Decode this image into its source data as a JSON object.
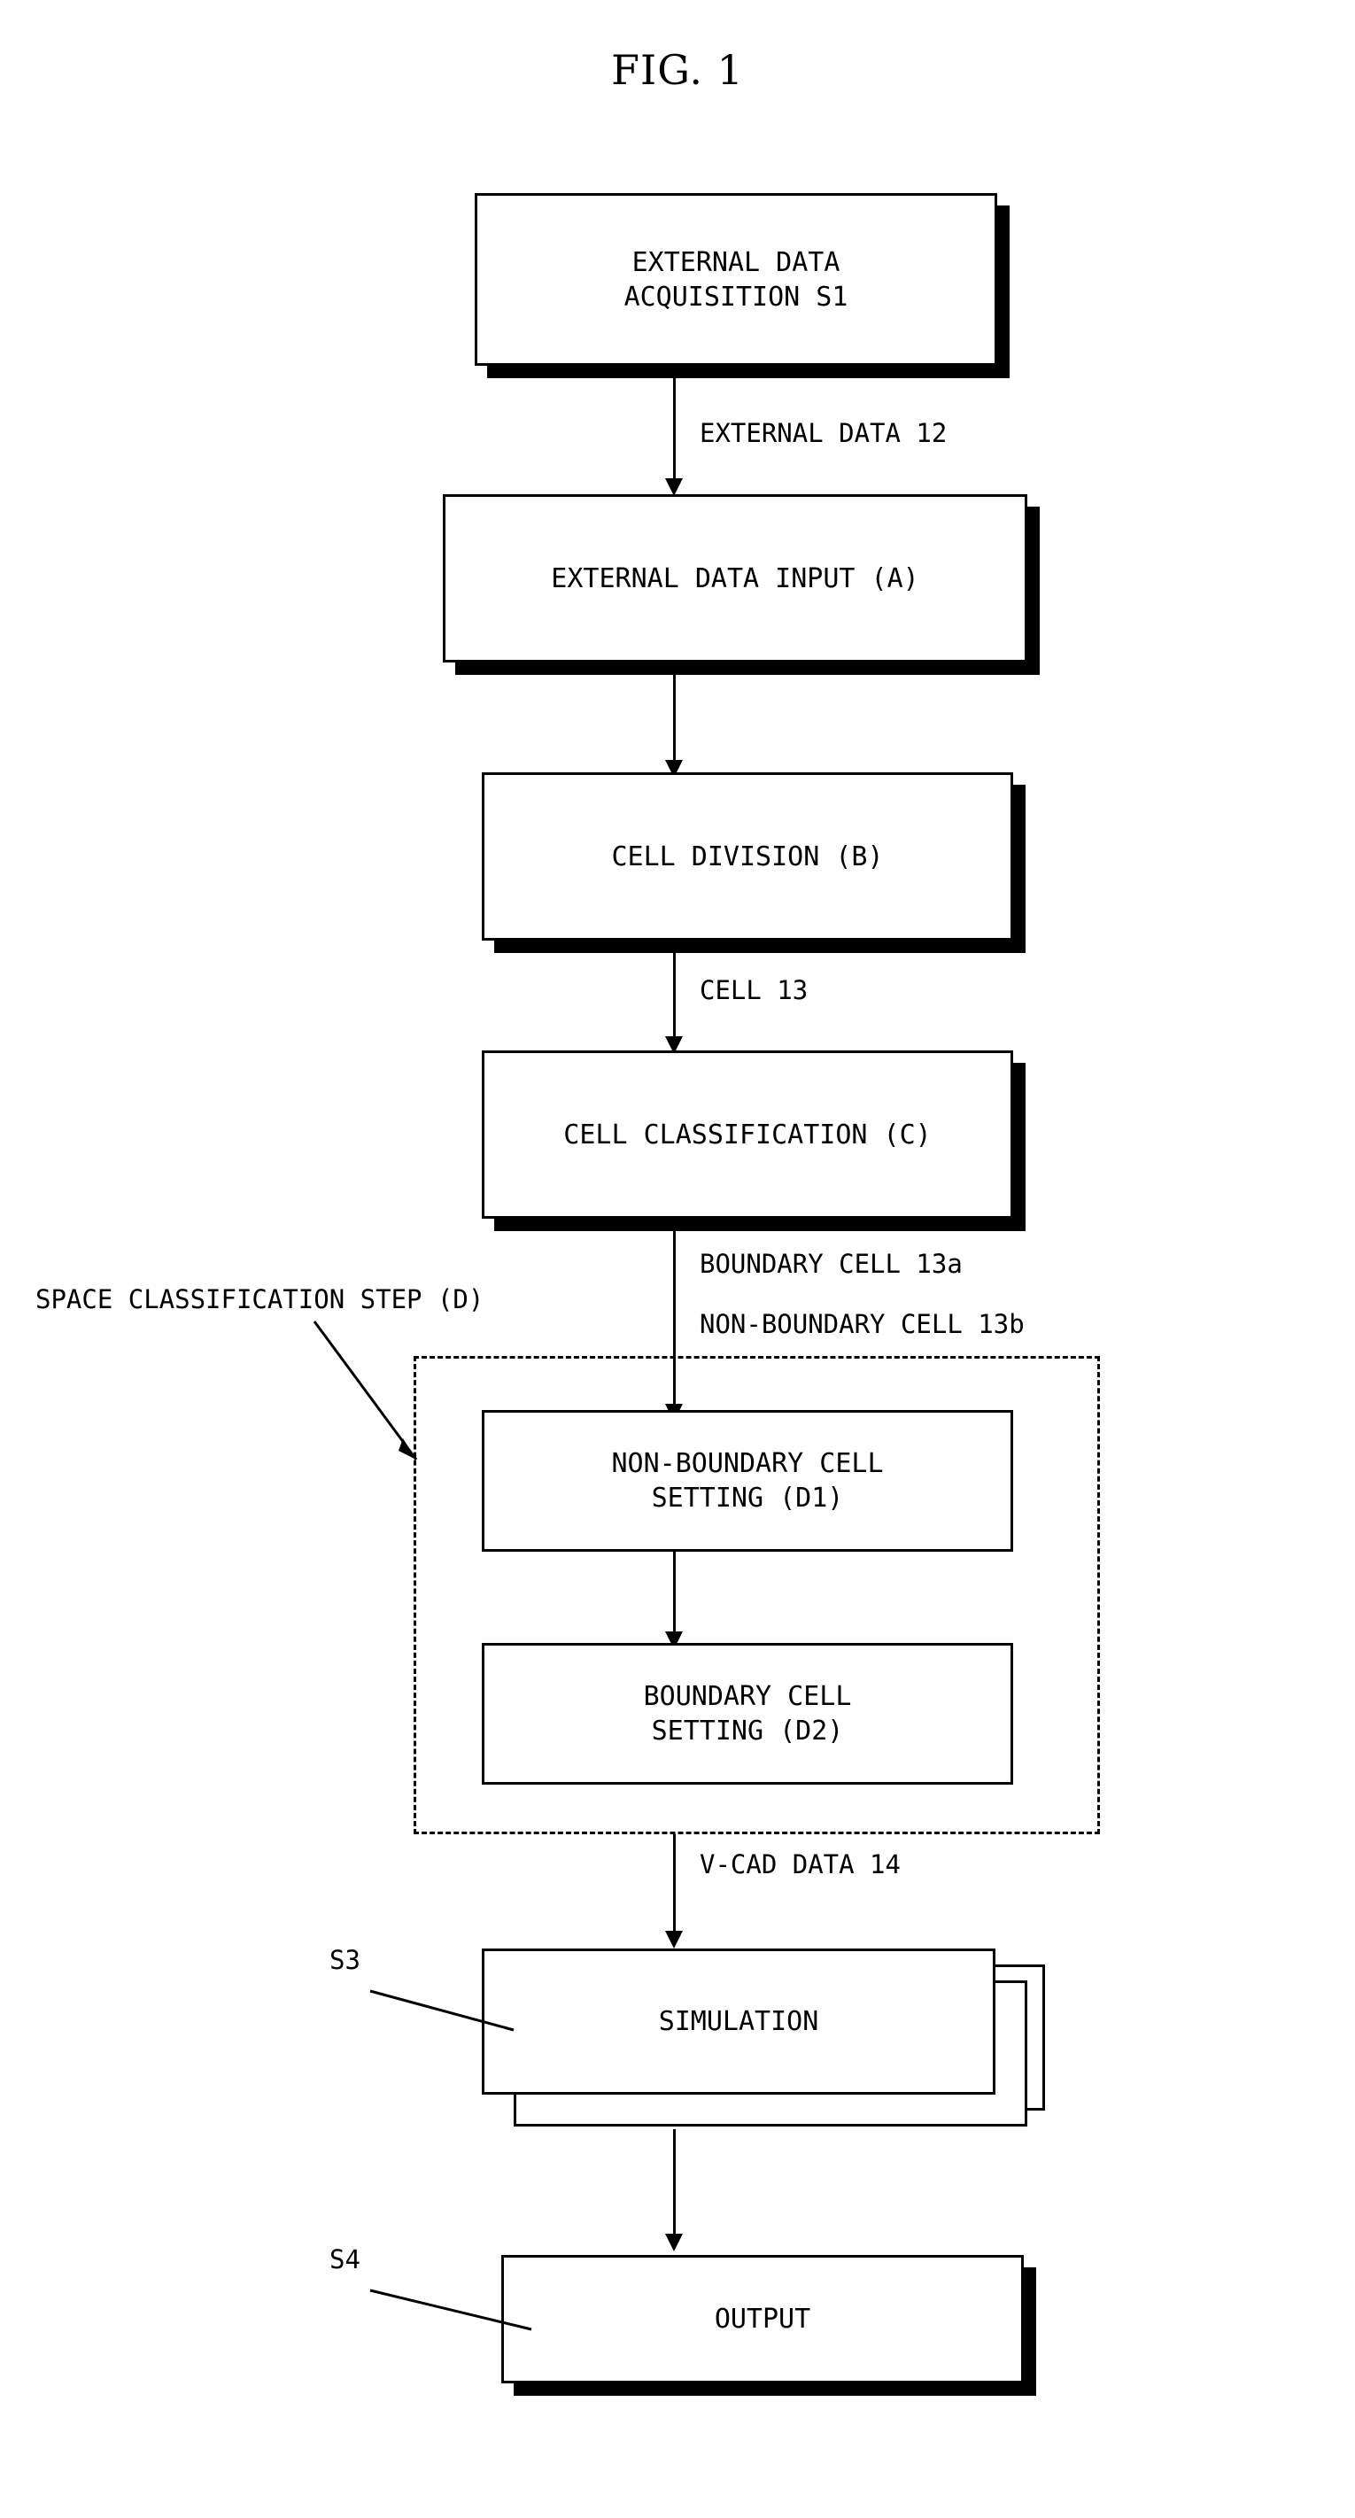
{
  "figure": {
    "title": "FIG. 1"
  },
  "nodes": {
    "s1": {
      "line1": "EXTERNAL DATA",
      "line2": "ACQUISITION S1"
    },
    "a": {
      "line1": "EXTERNAL DATA INPUT (A)"
    },
    "b": {
      "line1": "CELL DIVISION (B)"
    },
    "c": {
      "line1": "CELL CLASSIFICATION (C)"
    },
    "d1": {
      "line1": "NON-BOUNDARY CELL",
      "line2": "SETTING (D1)"
    },
    "d2": {
      "line1": "BOUNDARY CELL",
      "line2": "SETTING (D2)"
    },
    "sim": {
      "line1": "SIMULATION"
    },
    "out": {
      "line1": "OUTPUT"
    }
  },
  "labels": {
    "external_data_12": "EXTERNAL DATA 12",
    "cell_13": "CELL 13",
    "boundary_cell_13a": "BOUNDARY CELL 13a",
    "non_boundary_cell_13b": "NON-BOUNDARY CELL 13b",
    "space_classification_step": "SPACE CLASSIFICATION STEP (D)",
    "vcad_data_14": "V-CAD DATA 14",
    "s3": "S3",
    "s4": "S4"
  },
  "colors": {
    "stroke": "#000000",
    "background": "#ffffff"
  }
}
